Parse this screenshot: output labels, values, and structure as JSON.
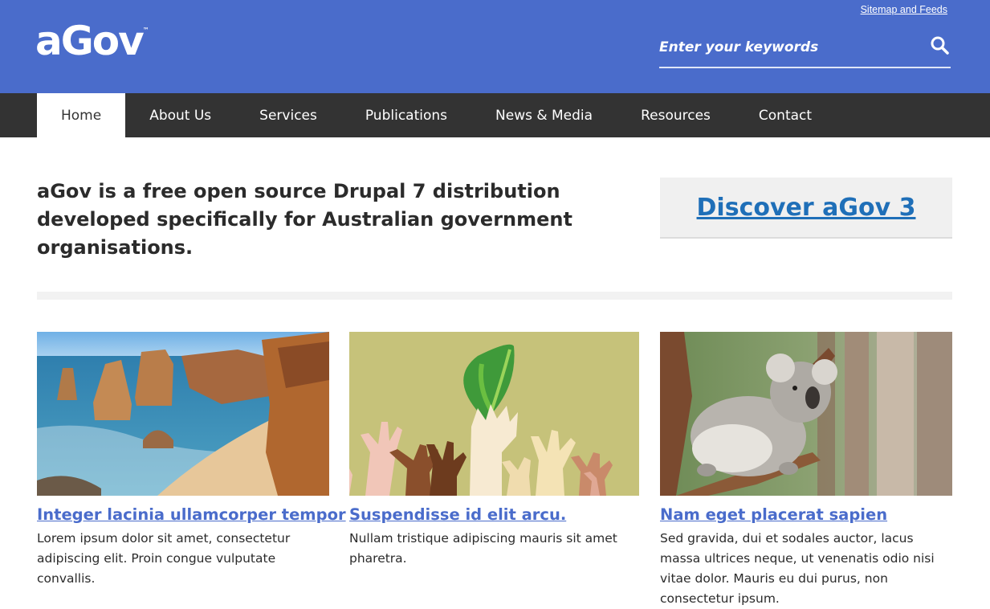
{
  "header": {
    "sitemap_label": "Sitemap and Feeds",
    "logo_text": "aGov",
    "logo_tm": "™",
    "search_placeholder": "Enter your keywords",
    "background_color": "#4a6ccb",
    "search_icon": "search-icon"
  },
  "nav": {
    "items": [
      {
        "label": "Home",
        "active": true
      },
      {
        "label": "About Us",
        "active": false
      },
      {
        "label": "Services",
        "active": false
      },
      {
        "label": "Publications",
        "active": false
      },
      {
        "label": "News & Media",
        "active": false
      },
      {
        "label": "Resources",
        "active": false
      },
      {
        "label": "Contact",
        "active": false
      }
    ]
  },
  "intro": {
    "text": "aGov is a free open source Drupal 7 distribution developed specifically for Australian government organisations.",
    "cta_label": "Discover aGov 3"
  },
  "cards": [
    {
      "image": "coastal-cliffs-photo",
      "title": "Integer lacinia ullamcorper tempor",
      "text": "Lorem ipsum dolor sit amet, consectetur adipiscing elit. Proin congue vulputate convallis."
    },
    {
      "image": "raised-hands-leaf-illustration",
      "title": "Suspendisse id elit arcu.",
      "text": "Nullam tristique adipiscing mauris sit amet pharetra."
    },
    {
      "image": "koala-photo",
      "title": "Nam eget placerat sapien",
      "text": "Sed gravida, dui et sodales auctor, lacus massa ultrices neque, ut venenatis odio nisi vitae dolor. Mauris eu dui purus, non consectetur ipsum."
    }
  ]
}
